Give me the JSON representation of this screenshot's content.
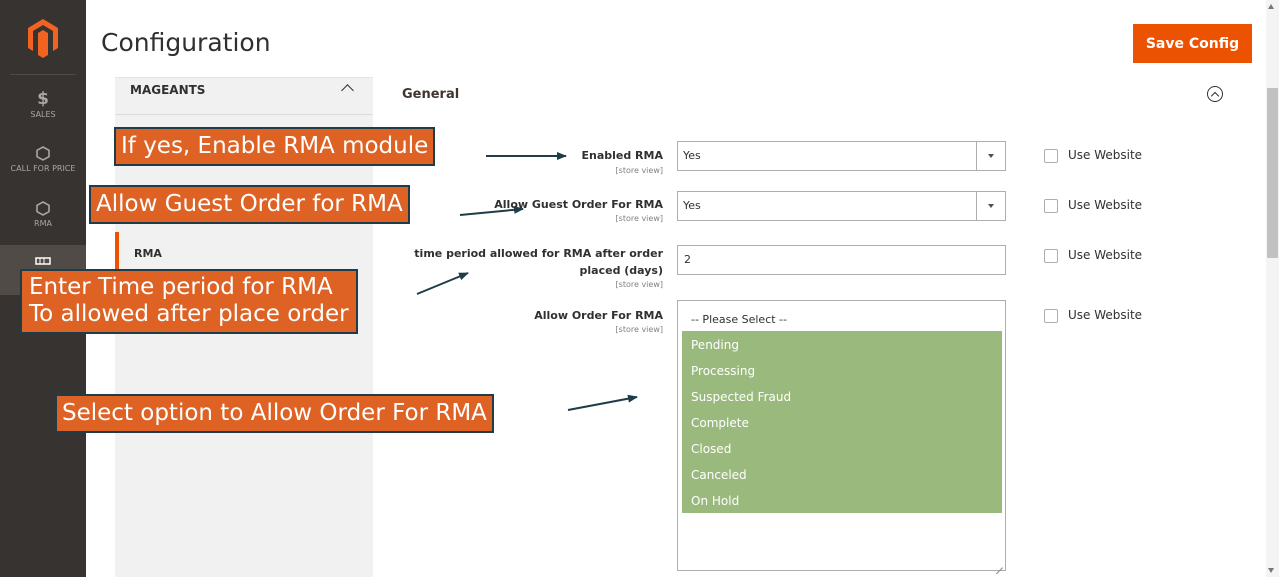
{
  "header": {
    "title": "Configuration",
    "save_label": "Save Config"
  },
  "admin_nav": {
    "items": [
      {
        "icon": "dollar-icon",
        "glyph": "$",
        "label": "SALES"
      },
      {
        "icon": "hexagon-icon",
        "label": "CALL FOR PRICE"
      },
      {
        "icon": "hexagon-icon",
        "label": "RMA"
      }
    ]
  },
  "tabs": {
    "group_label": "MAGEANTS",
    "active_item": "RMA"
  },
  "section": {
    "title": "General"
  },
  "fields": {
    "enabled_rma": {
      "label": "Enabled RMA",
      "scope": "[store view]",
      "value": "Yes",
      "use_website": "Use Website"
    },
    "allow_guest": {
      "label": "Allow Guest Order For RMA",
      "scope": "[store view]",
      "value": "Yes",
      "use_website": "Use Website"
    },
    "time_period": {
      "label_line1": "time period allowed for RMA after order",
      "label_line2": "placed (days)",
      "scope": "[store view]",
      "value": "2",
      "use_website": "Use Website"
    },
    "allow_order": {
      "label": "Allow Order For RMA",
      "scope": "[store view]",
      "placeholder": "-- Please Select --",
      "options": [
        "Pending",
        "Processing",
        "Suspected Fraud",
        "Complete",
        "Closed",
        "Canceled",
        "On Hold"
      ],
      "use_website": "Use Website"
    }
  },
  "annotations": {
    "enable_module": "If yes, Enable RMA module",
    "guest_order": "Allow Guest Order for RMA",
    "time_period_line1": "Enter Time period for RMA",
    "time_period_line2": "To allowed after place order",
    "allow_order": "Select option to Allow Order For RMA"
  },
  "colors": {
    "accent": "#eb5202",
    "nav_bg": "#373330",
    "selected_option": "#9aba7d",
    "callout_bg": "#dd6224",
    "callout_border": "#1f3d49"
  }
}
